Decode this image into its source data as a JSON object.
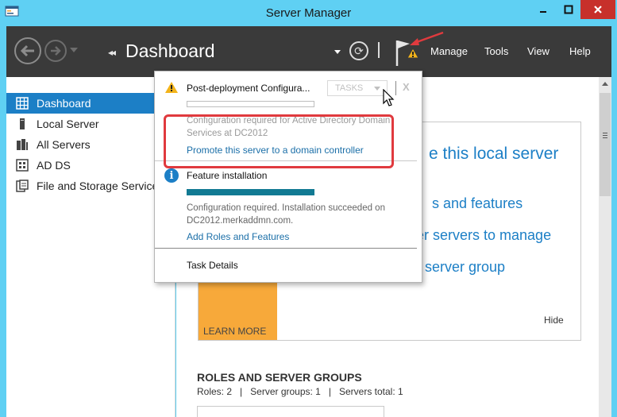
{
  "window": {
    "title": "Server Manager",
    "close_color": "#c7302b"
  },
  "command_bar": {
    "breadcrumb": "Dashboard",
    "menu": [
      "Manage",
      "Tools",
      "View",
      "Help"
    ]
  },
  "left_nav": {
    "items": [
      {
        "label": "Dashboard",
        "icon": "dashboard-grid-icon",
        "active": true
      },
      {
        "label": "Local Server",
        "icon": "server-icon",
        "active": false
      },
      {
        "label": "All Servers",
        "icon": "servers-icon",
        "active": false
      },
      {
        "label": "AD DS",
        "icon": "ad-ds-icon",
        "active": false
      },
      {
        "label": "File and Storage Services",
        "icon": "storage-icon",
        "active": false
      }
    ]
  },
  "quick_start": {
    "line1": "e this local server",
    "line2": "s and features",
    "line3": "er servers to manage",
    "line4": "server group",
    "learn_more": "LEARN MORE",
    "hide": "Hide"
  },
  "roles": {
    "title": "ROLES AND SERVER GROUPS",
    "stats": "Roles: 2   |   Server groups: 1   |   Servers total: 1"
  },
  "notifications": {
    "post_deploy": {
      "title": "Post-deployment Configura...",
      "tasks_label": "TASKS",
      "close": "X",
      "description": "Configuration required for Active Directory Domain Services at DC2012",
      "link": "Promote this server to a domain controller"
    },
    "feature_install": {
      "title": "Feature installation",
      "progress": 1.0,
      "description": "Configuration required. Installation succeeded on DC2012.merkaddmn.com.",
      "link": "Add Roles and Features"
    },
    "task_details": "Task Details"
  },
  "colors": {
    "accent": "#1c7fc6",
    "orange": "#f7a93a",
    "annotation": "#e03a3e",
    "progress": "#127a93"
  }
}
